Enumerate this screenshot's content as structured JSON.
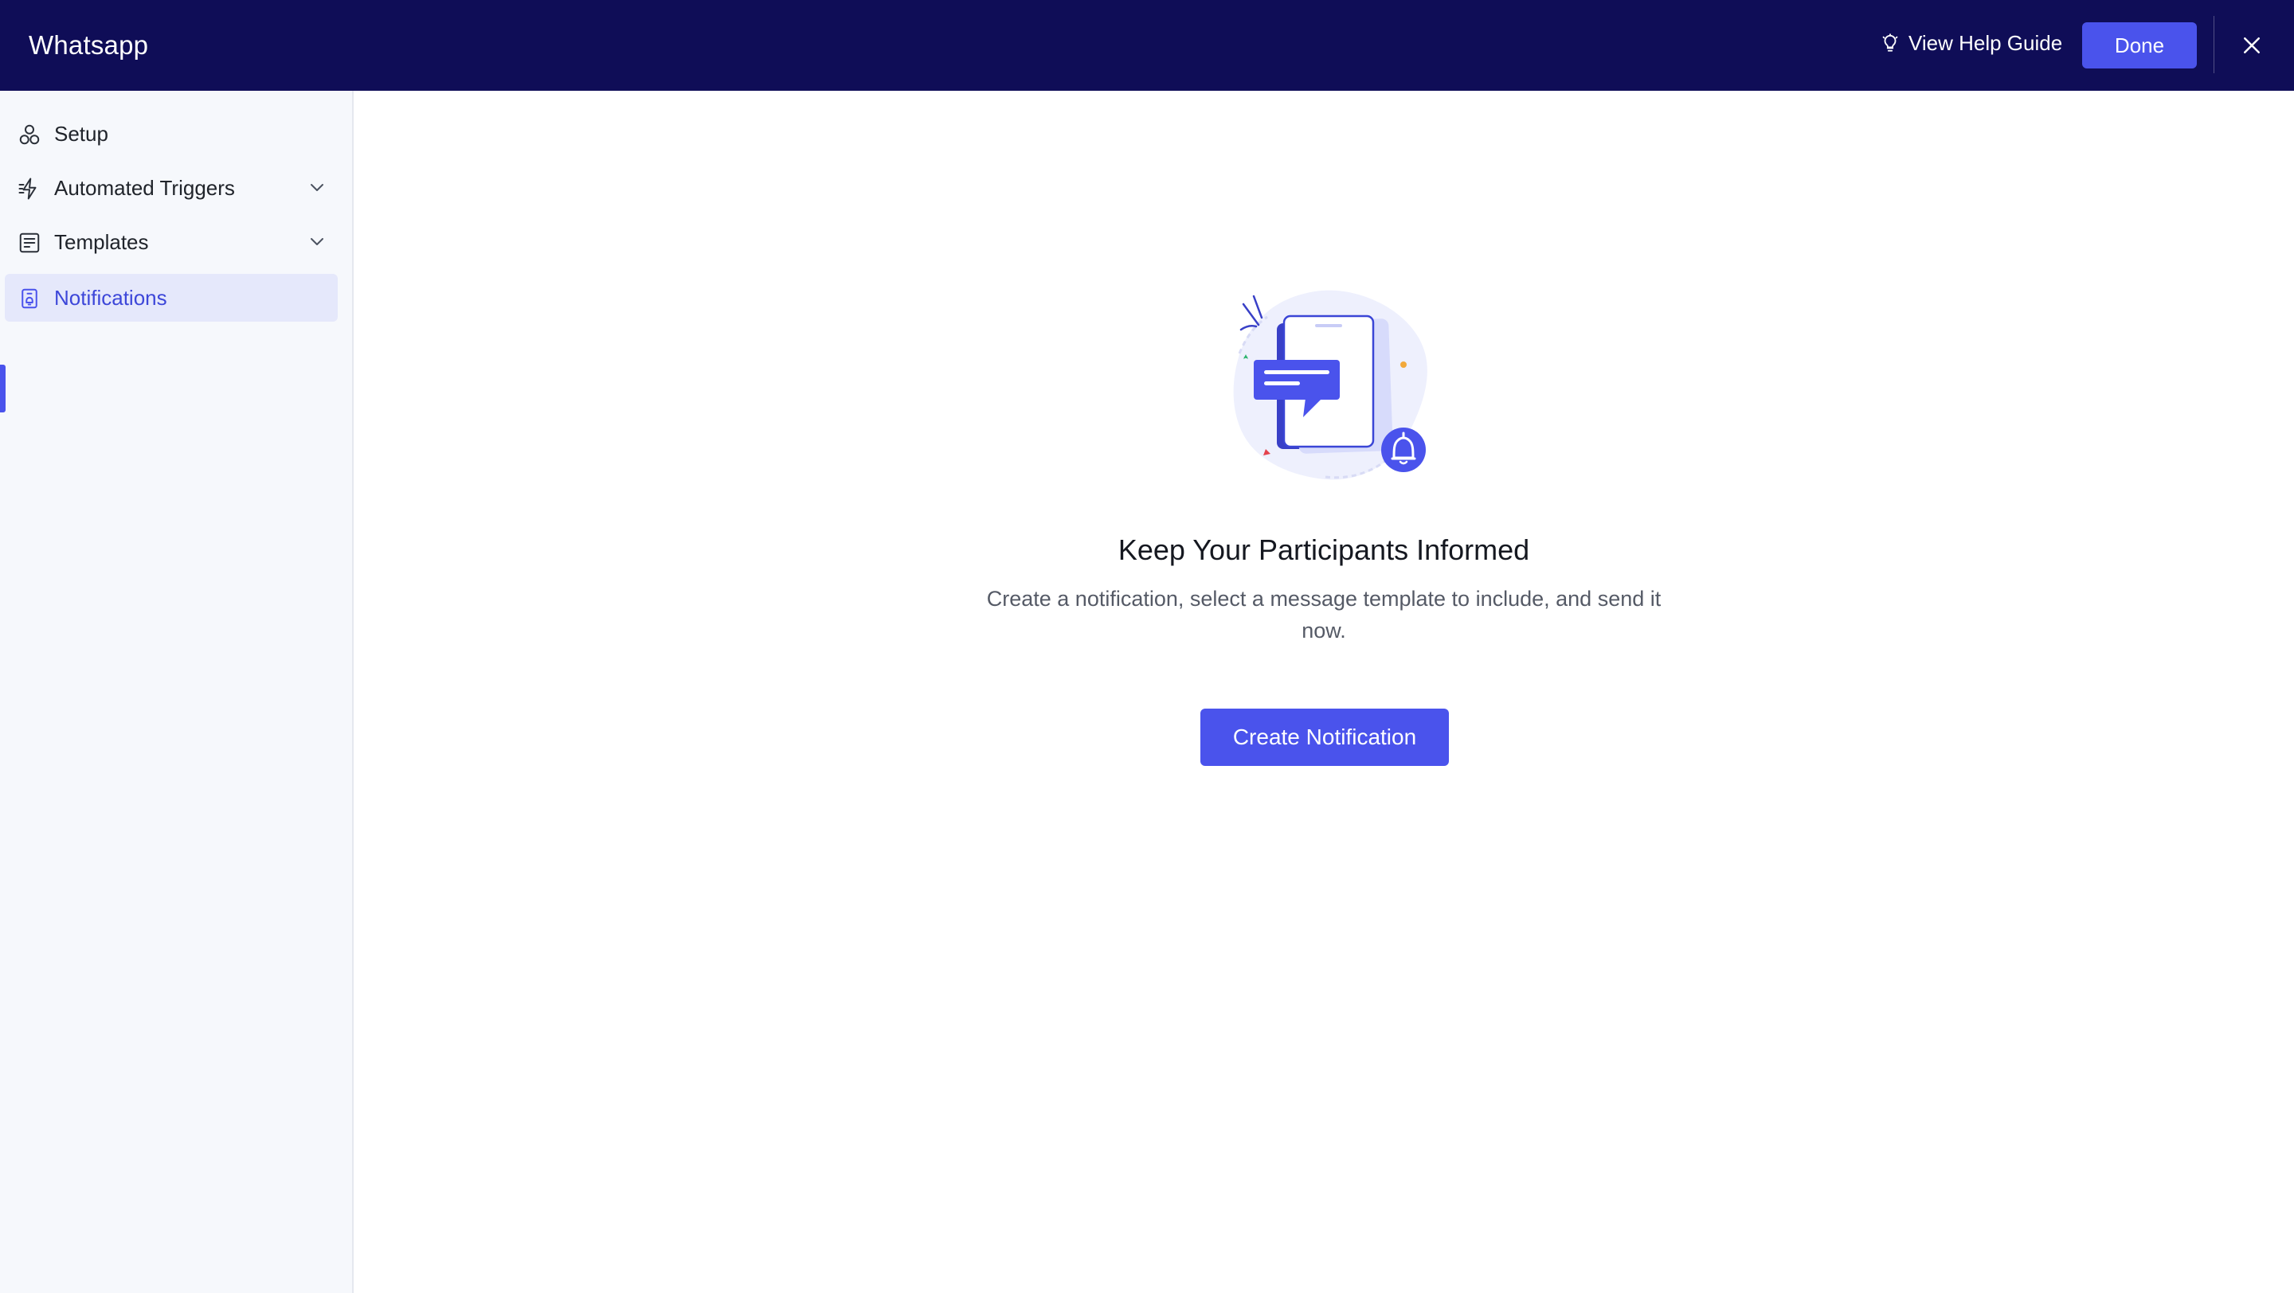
{
  "header": {
    "title": "Whatsapp",
    "help_label": "View Help Guide",
    "done_label": "Done"
  },
  "sidebar": {
    "items": [
      {
        "label": "Setup",
        "icon": "setup-icon",
        "expandable": false,
        "active": false
      },
      {
        "label": "Automated Triggers",
        "icon": "triggers-icon",
        "expandable": true,
        "active": false
      },
      {
        "label": "Templates",
        "icon": "templates-icon",
        "expandable": true,
        "active": false
      },
      {
        "label": "Notifications",
        "icon": "notifications-icon",
        "expandable": false,
        "active": true
      }
    ]
  },
  "empty_state": {
    "title": "Keep Your Participants Informed",
    "description": "Create a notification, select a message template to include, and send it now.",
    "button_label": "Create Notification"
  },
  "colors": {
    "header_bg": "#0f0d57",
    "primary": "#4a53ec",
    "sidebar_bg": "#f6f8fc",
    "active_bg": "#e5e8fb",
    "active_text": "#3d47d9"
  }
}
